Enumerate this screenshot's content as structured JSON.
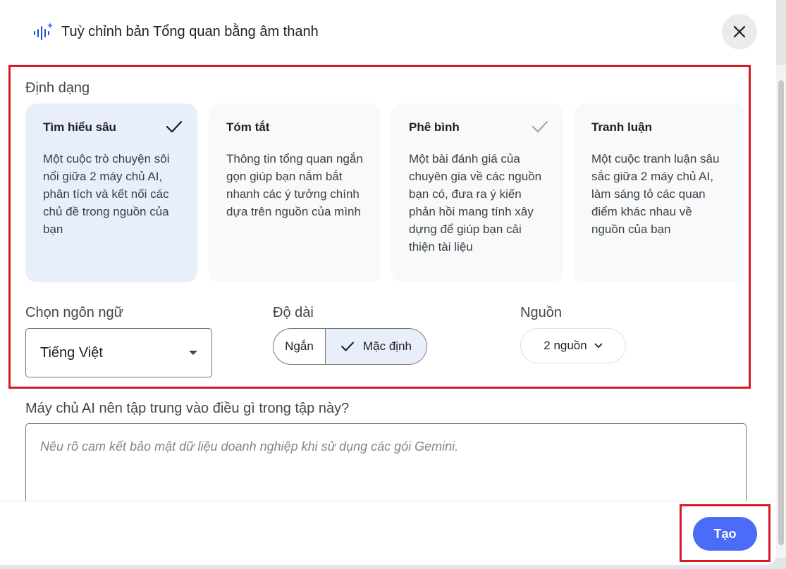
{
  "dialog": {
    "title": "Tuỳ chỉnh bản Tổng quan bằng âm thanh",
    "title_icon": "audio-sparkle-icon",
    "close_icon": "close-icon"
  },
  "format": {
    "label": "Định dạng",
    "cards": [
      {
        "title": "Tìm hiểu sâu",
        "description": "Một cuộc trò chuyện sôi nổi giữa 2 máy chủ AI, phân tích và kết nối các chủ đề trong nguồn của bạn",
        "selected": true
      },
      {
        "title": "Tóm tắt",
        "description": "Thông tin tổng quan ngắn gọn giúp bạn nắm bắt nhanh các ý tưởng chính dựa trên nguồn của mình",
        "selected": false
      },
      {
        "title": "Phê bình",
        "description": "Một bài đánh giá của chuyên gia về các nguồn bạn có, đưa ra ý kiến phản hồi mang tính xây dựng để giúp bạn cải thiện tài liệu",
        "selected": false
      },
      {
        "title": "Tranh luận",
        "description": "Một cuộc tranh luận sâu sắc giữa 2 máy chủ AI, làm sáng tỏ các quan điểm khác nhau về nguồn của bạn",
        "selected": false
      }
    ]
  },
  "language": {
    "label": "Chọn ngôn ngữ",
    "selected": "Tiếng Việt"
  },
  "length": {
    "label": "Độ dài",
    "options": [
      "Ngắn",
      "Mặc định"
    ],
    "selected": "Mặc định"
  },
  "sources": {
    "label": "Nguồn",
    "value": "2 nguồn"
  },
  "focus": {
    "label": "Máy chủ AI nên tập trung vào điều gì trong tập này?",
    "placeholder": "Nêu rõ cam kết bảo mật dữ liệu doanh nghiệp khi sử dụng các gói Gemini."
  },
  "footer": {
    "create_label": "Tạo"
  },
  "colors": {
    "accent": "#4a6cf7",
    "selected_card": "#e8eefa",
    "highlight_border": "#d71a25"
  }
}
